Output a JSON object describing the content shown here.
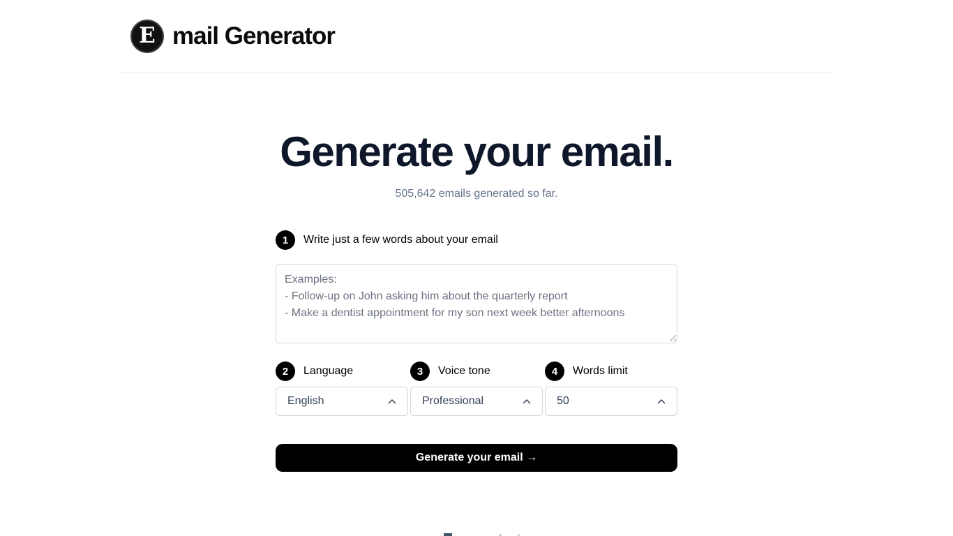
{
  "header": {
    "logo_letter": "E",
    "brand_text": "mail Generator"
  },
  "hero": {
    "title": "Generate your email.",
    "counter": "505,642 emails generated so far."
  },
  "step1": {
    "number": "1",
    "label": "Write just a few words about your email",
    "placeholder": "Examples:\n- Follow-up on John asking him about the quarterly report\n- Make a dentist appointment for my son next week better afternoons",
    "value": ""
  },
  "step2": {
    "number": "2",
    "label": "Language",
    "selected": "English"
  },
  "step3": {
    "number": "3",
    "label": "Voice tone",
    "selected": "Professional"
  },
  "step4": {
    "number": "4",
    "label": "Words limit",
    "selected": "50"
  },
  "generate_button": {
    "label": "Generate your email →"
  },
  "icons": {
    "logo": "letter-e-logo-icon",
    "select_chevron": "chevron-up-icon",
    "resize": "resize-grip-icon"
  },
  "colors": {
    "primary": "#000000",
    "title": "#0f172a",
    "muted": "#64748b",
    "border": "#d1d5db"
  }
}
